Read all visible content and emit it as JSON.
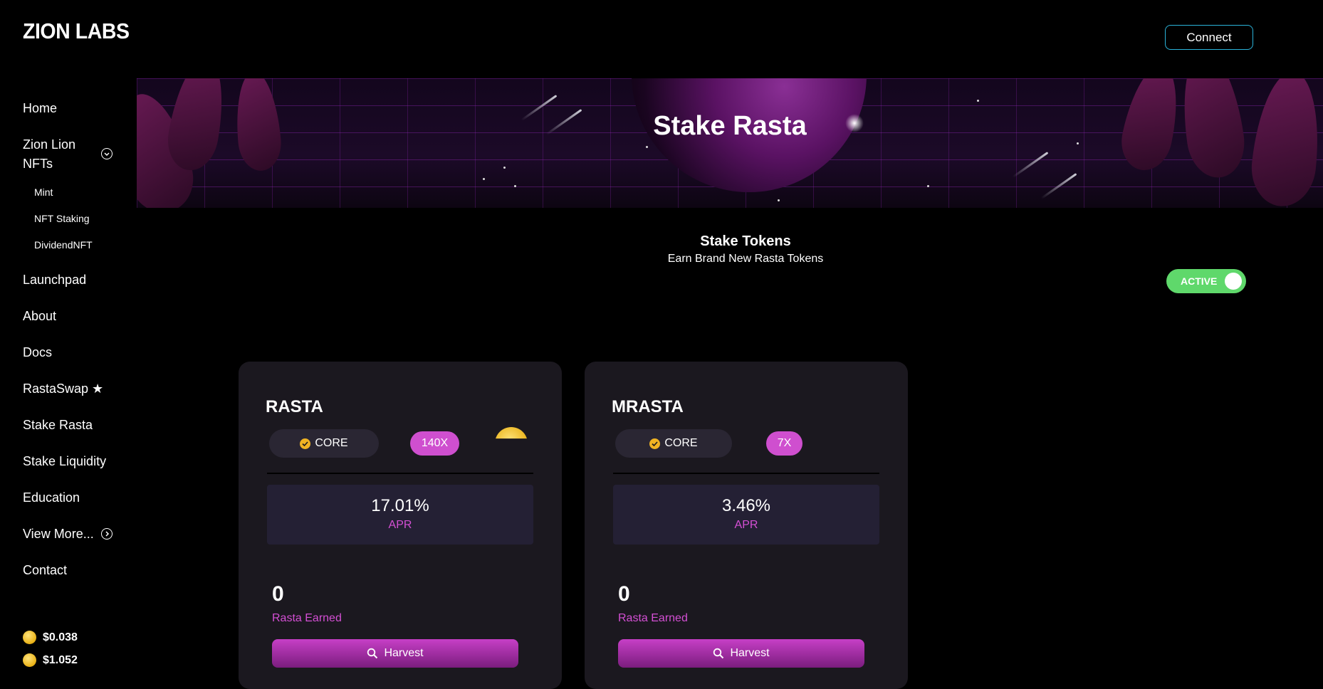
{
  "header": {
    "logo": "ZION LABS",
    "connect_label": "Connect"
  },
  "sidebar": {
    "items": {
      "home": "Home",
      "zion_lion_nfts_line1": "Zion Lion",
      "zion_lion_nfts_line2": "NFTs",
      "mint": "Mint",
      "nft_staking": "NFT Staking",
      "dividend_nft": "DividendNFT",
      "launchpad": "Launchpad",
      "about": "About",
      "docs": "Docs",
      "rastaswap": "RastaSwap ★",
      "stake_rasta": "Stake Rasta",
      "stake_liquidity": "Stake Liquidity",
      "education": "Education",
      "view_more": "View More...",
      "contact": "Contact"
    },
    "prices": [
      "$0.038",
      "$1.052"
    ]
  },
  "banner": {
    "title": "Stake Rasta"
  },
  "section": {
    "title": "Stake Tokens",
    "subtitle": "Earn Brand New Rasta Tokens",
    "toggle_label": "ACTIVE"
  },
  "pools": [
    {
      "name": "RASTA",
      "core_label": "CORE",
      "multiplier": "140X",
      "apr_value": "17.01%",
      "apr_label": "APR",
      "earned_value": "0",
      "earned_label": "Rasta Earned",
      "harvest_label": "Harvest"
    },
    {
      "name": "MRASTA",
      "core_label": "CORE",
      "multiplier": "7X",
      "apr_value": "3.46%",
      "apr_label": "APR",
      "earned_value": "0",
      "earned_label": "Rasta Earned",
      "harvest_label": "Harvest"
    }
  ],
  "colors": {
    "accent": "#d44fd4",
    "toggle": "#5fd86b",
    "connect_border": "#2bb3d9",
    "card": "#1b181f"
  }
}
